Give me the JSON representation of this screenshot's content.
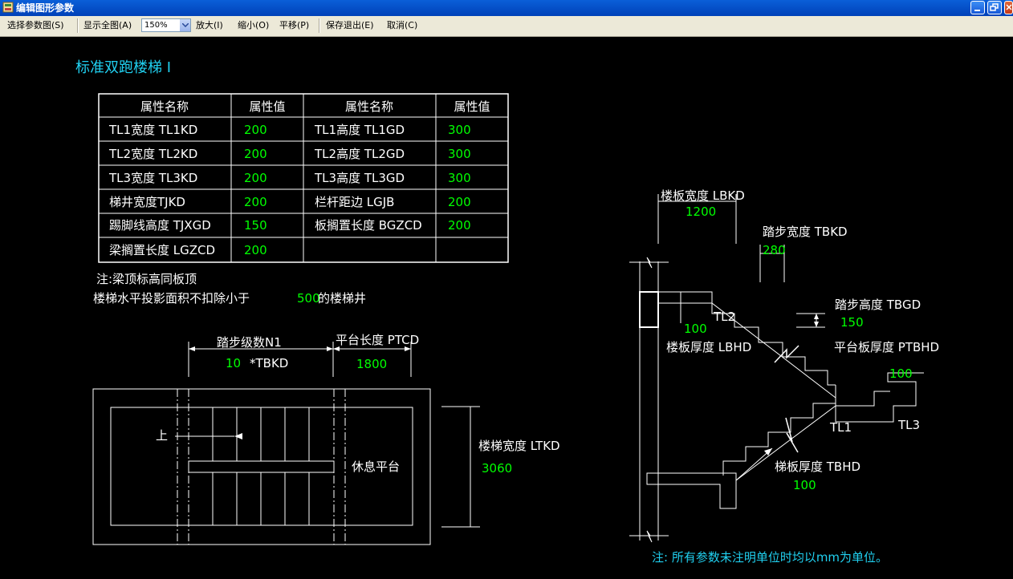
{
  "window": {
    "title": "编辑图形参数"
  },
  "toolbar": {
    "select_label": "选择参数图(S)",
    "show_all_label": "显示全图(A)",
    "zoom_value": "150%",
    "zoom_in_label": "放大(I)",
    "zoom_out_label": "缩小(O)",
    "pan_label": "平移(P)",
    "save_exit_label": "保存退出(E)",
    "cancel_label": "取消(C)"
  },
  "drawing": {
    "title": "标准双跑楼梯 I",
    "table": {
      "headers": [
        "属性名称",
        "属性值",
        "属性名称",
        "属性值"
      ],
      "rows": [
        {
          "name1": "TL1宽度 TL1KD",
          "val1": "200",
          "name2": "TL1高度 TL1GD",
          "val2": "300"
        },
        {
          "name1": "TL2宽度 TL2KD",
          "val1": "200",
          "name2": "TL2高度 TL2GD",
          "val2": "300"
        },
        {
          "name1": "TL3宽度 TL3KD",
          "val1": "200",
          "name2": "TL3高度 TL3GD",
          "val2": "300"
        },
        {
          "name1": "梯井宽度TJKD",
          "val1": "200",
          "name2": "栏杆距边 LGJB",
          "val2": "200"
        },
        {
          "name1": "踢脚线高度 TJXGD",
          "val1": "150",
          "name2": "板搁置长度 BGZCD",
          "val2": "200"
        },
        {
          "name1": "梁搁置长度 LGZCD",
          "val1": "200",
          "name2": "",
          "val2": ""
        }
      ]
    },
    "notes": {
      "beam_note": "注:梁顶标高同板顶",
      "area_note_prefix": "楼梯水平投影面积不扣除小于",
      "area_note_value": "500",
      "area_note_suffix": "的楼梯井"
    },
    "plan": {
      "steps_label": "踏步级数N1",
      "steps_value": "10",
      "steps_unit": "*TBKD",
      "platform_length_label": "平台长度 PTCD",
      "platform_length_value": "1800",
      "up_label": "上",
      "landing_label": "休息平台",
      "stair_width_label": "楼梯宽度 LTKD",
      "stair_width_value": "3060"
    },
    "section": {
      "floor_slab_width_label": "楼板宽度 LBKD",
      "floor_slab_width_value": "1200",
      "tread_width_label": "踏步宽度 TBKD",
      "tread_width_value": "280",
      "riser_height_label": "踏步高度 TBGD",
      "riser_height_value": "150",
      "tl2_label": "TL2",
      "floor_slab_thickness_value": "100",
      "floor_slab_thickness_label": "楼板厚度 LBHD",
      "platform_slab_thickness_label": "平台板厚度 PTBHD",
      "platform_slab_thickness_value": "100",
      "tl1_label": "TL1",
      "tl3_label": "TL3",
      "stair_slab_thickness_label": "梯板厚度 TBHD",
      "stair_slab_thickness_value": "100"
    },
    "footer_note": "注: 所有参数未注明单位时均以mm为单位。"
  },
  "colors": {
    "background": "#000000",
    "line": "#ffffff",
    "value": "#00ff00",
    "title": "#20d0f0",
    "toolbar": "#ece9d8",
    "titlebar": "#0a5fd8"
  }
}
